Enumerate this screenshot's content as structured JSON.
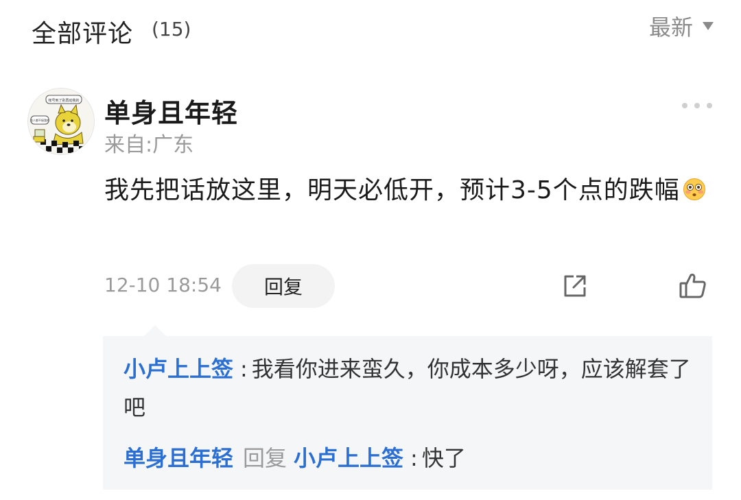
{
  "header": {
    "title": "全部评论",
    "count": "(15)",
    "sort_label": "最新"
  },
  "comment": {
    "username": "单身且年轻",
    "location": "来自:广东",
    "body": "我先把话放这里，明天必低开，预计3-5个点的跌幅",
    "emoji": "flushed-face-emoji",
    "timestamp": "12-10 18:54",
    "reply_label": "回复",
    "avatar_icon": "shiba-doge-avatar",
    "avatar_caption_1": "帐号到了别再动我的",
    "avatar_caption_2": "别人都不接我的"
  },
  "replies": [
    {
      "user": "小卢上上签",
      "separator": ":",
      "text": "我看你进来蛮久，你成本多少呀，应该解套了吧"
    },
    {
      "user": "单身且年轻",
      "reply_word": "回复",
      "target": "小卢上上签",
      "separator": ":",
      "text": "快了"
    }
  ],
  "colors": {
    "link_blue": "#2a6fd1",
    "muted_gray": "#9a9a9a",
    "reply_bg": "#f5f6f7"
  },
  "icons": {
    "share": "share-icon",
    "like": "thumbs-up-icon",
    "more": "more-dots-icon",
    "sort": "caret-down-icon"
  }
}
